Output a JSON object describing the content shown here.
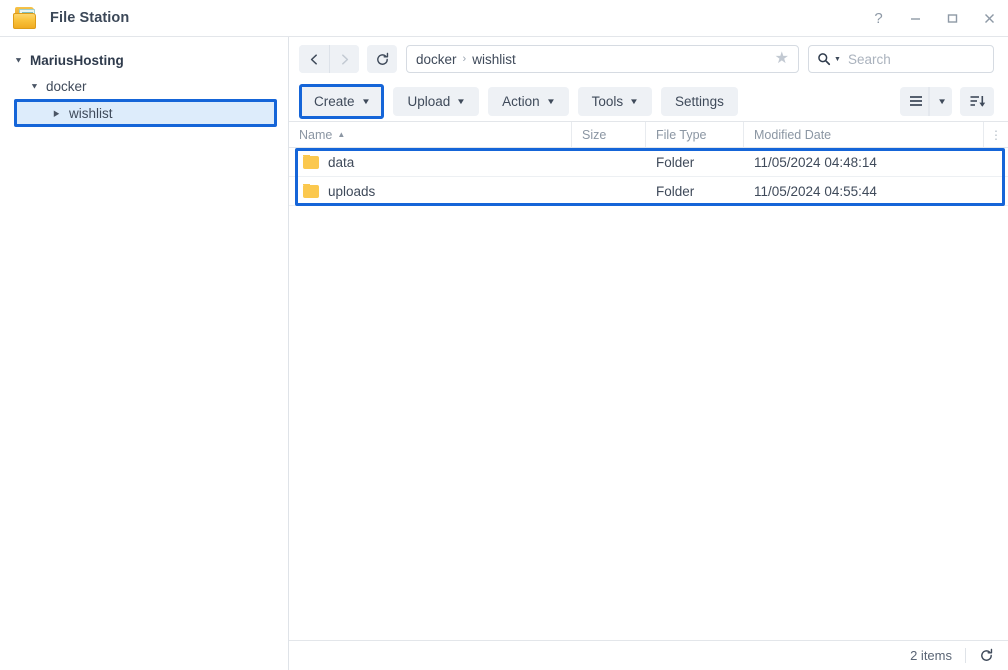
{
  "window": {
    "title": "File Station",
    "app_icon": "folder-icon",
    "controls": {
      "help": "?",
      "minimize": "minimize-icon",
      "maximize": "maximize-icon",
      "close": "close-icon"
    }
  },
  "sidebar": {
    "items": [
      {
        "label": "MariusHosting",
        "level": 0,
        "caret": "down",
        "selected": false
      },
      {
        "label": "docker",
        "level": 1,
        "caret": "down",
        "selected": false
      },
      {
        "label": "wishlist",
        "level": 2,
        "caret": "right",
        "selected": true
      }
    ]
  },
  "navbar": {
    "back_icon": "chevron-left-icon",
    "forward_icon": "chevron-right-icon",
    "refresh_icon": "refresh-icon",
    "breadcrumb": [
      "docker",
      "wishlist"
    ],
    "breadcrumb_separator": "›",
    "favorite_icon": "star-icon",
    "search": {
      "placeholder": "Search",
      "icon": "search-icon"
    }
  },
  "toolbar": {
    "create_label": "Create",
    "upload_label": "Upload",
    "action_label": "Action",
    "tools_label": "Tools",
    "settings_label": "Settings",
    "view_mode_icon": "list-view-icon",
    "sort_icon": "sort-descending-icon"
  },
  "filelist": {
    "columns": [
      "Name",
      "Size",
      "File Type",
      "Modified Date"
    ],
    "sort_column": "Name",
    "sort_direction": "ascending",
    "menu_icon": "kebab-menu-icon",
    "rows": [
      {
        "name": "data",
        "size": "",
        "type": "Folder",
        "modified": "11/05/2024 04:48:14",
        "icon": "folder-icon"
      },
      {
        "name": "uploads",
        "size": "",
        "type": "Folder",
        "modified": "11/05/2024 04:55:44",
        "icon": "folder-icon"
      }
    ]
  },
  "statusbar": {
    "count": "2 items",
    "refresh_icon": "refresh-icon"
  },
  "colors": {
    "annotation": "#1565d8",
    "folder": "#fbc84e",
    "toolbar_button": "#eef1f5",
    "selection": "#ddecfb"
  }
}
